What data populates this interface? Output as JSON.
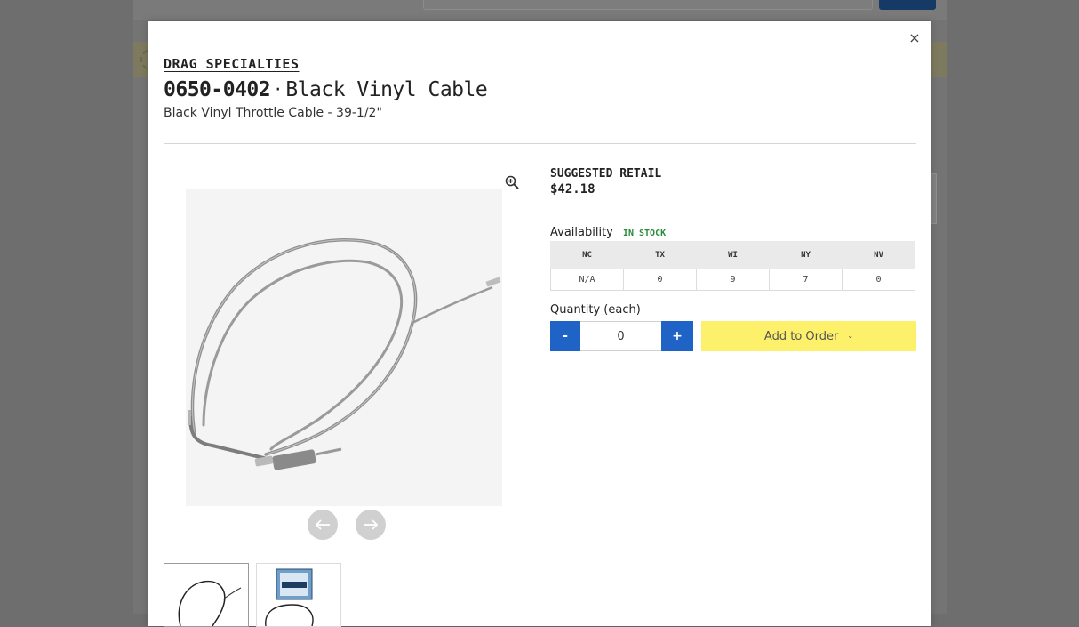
{
  "modal": {
    "close_label": "×",
    "brand": "DRAG SPECIALTIES",
    "part_number": "0650-0402",
    "separator": "·",
    "part_name": "Black Vinyl Cable",
    "subtitle": "Black Vinyl Throttle Cable - 39-1/2\""
  },
  "pricing": {
    "label": "SUGGESTED RETAIL",
    "price": "$42.18"
  },
  "availability": {
    "label": "Availability",
    "status": "IN STOCK",
    "status_color": "#2a8a3a",
    "warehouses": [
      {
        "code": "NC",
        "qty": "N/A"
      },
      {
        "code": "TX",
        "qty": "0"
      },
      {
        "code": "WI",
        "qty": "9"
      },
      {
        "code": "NY",
        "qty": "7"
      },
      {
        "code": "NV",
        "qty": "0"
      }
    ]
  },
  "quantity": {
    "label": "Quantity (each)",
    "minus_label": "-",
    "plus_label": "+",
    "value": "0"
  },
  "order": {
    "add_label": "Add to Order",
    "chevron": "⌄",
    "accent": "#fdf06b"
  },
  "icons": {
    "close": "close-icon",
    "zoom": "zoom-in-icon",
    "prev": "arrow-left-icon",
    "next": "arrow-right-icon",
    "dropdown": "chevron-down-icon"
  },
  "colors": {
    "qty_button": "#1f63c6"
  }
}
